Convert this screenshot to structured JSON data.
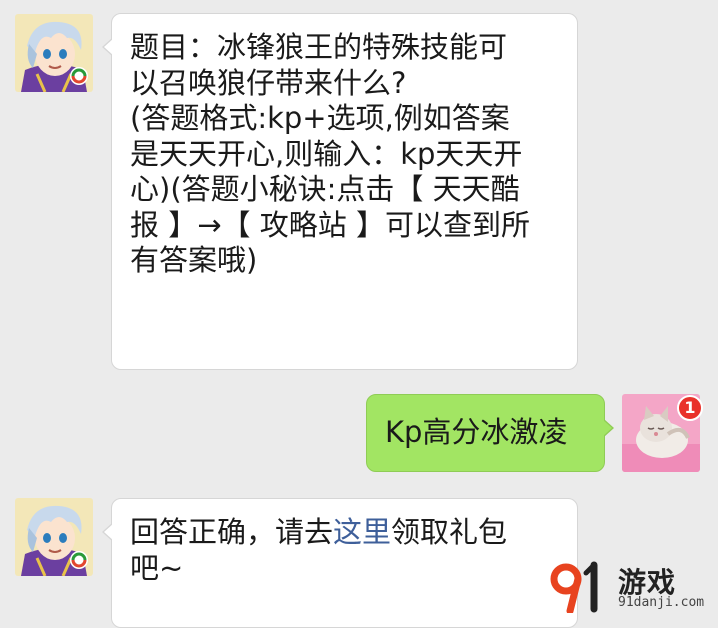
{
  "chat": {
    "messages": [
      {
        "sender": "bot",
        "lines": [
          "题目：冰锋狼王的特殊技能可",
          "以召唤狼仔带来什么?",
          "(答题格式:kp+选项,例如答案",
          "是天天开心,则输入：kp天天开",
          "心)(答题小秘诀:点击【 天天酷",
          "报 】→【 攻略站 】可以查到所",
          "有答案哦)"
        ]
      },
      {
        "sender": "user",
        "text": "Kp高分冰激凌",
        "unread_badge": "1"
      },
      {
        "sender": "bot",
        "line1_before": "回答正确，请去",
        "line1_link": "这里",
        "line1_after": "领取礼包",
        "line2": "吧~"
      }
    ]
  },
  "watermark": {
    "logo_text": "游戏",
    "url": "91danji.com"
  },
  "colors": {
    "background": "#ebebeb",
    "bot_bubble": "#ffffff",
    "user_bubble": "#a2e563",
    "link": "#3e5f9a",
    "badge": "#e9312b"
  },
  "icons": {
    "bot_avatar": "anime-character-avatar",
    "user_avatar": "kitten-photo-avatar",
    "watermark_logo": "91-logo-icon"
  }
}
